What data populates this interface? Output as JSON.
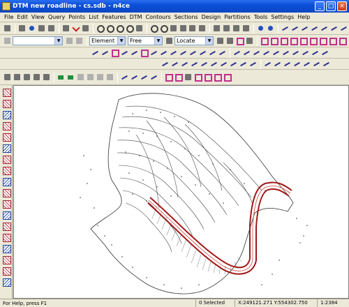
{
  "window": {
    "title": "DTM new roadline - cs.sdb - n4ce",
    "minimize_glyph": "_",
    "maximize_glyph": "□",
    "close_glyph": "×"
  },
  "menu": [
    "File",
    "Edit",
    "View",
    "Query",
    "Points",
    "List",
    "Features",
    "DTM",
    "Contours",
    "Sections",
    "Design",
    "Partitions",
    "Tools",
    "Settings",
    "Help"
  ],
  "toolbar": {
    "combo_blank": "",
    "element_select": "Element",
    "free_select": "Free",
    "locate_select": "Locate"
  },
  "status": {
    "help_text": "For Help, press F1",
    "selection": "0 Selected",
    "coordinates": "X:249121.271  Y:554302.750",
    "scale": "1:2384"
  },
  "colors": {
    "title_blue": "#0a4fd8",
    "road_red": "#a01818",
    "contour_black": "#222222"
  }
}
